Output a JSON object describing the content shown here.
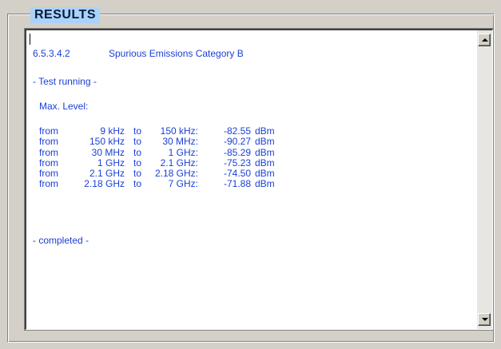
{
  "group": {
    "title": "RESULTS"
  },
  "results": {
    "section_number": "6.5.3.4.2",
    "section_title": "Spurious Emissions Category B",
    "running_text": "- Test running -",
    "max_level_label": "Max. Level:",
    "rows": [
      {
        "from_word": "from",
        "f1": "9 kHz",
        "to_word": "to",
        "f2": "150 kHz:",
        "value": "-82.55",
        "unit": "dBm"
      },
      {
        "from_word": "from",
        "f1": "150 kHz",
        "to_word": "to",
        "f2": "30 MHz:",
        "value": "-90.27",
        "unit": "dBm"
      },
      {
        "from_word": "from",
        "f1": "30 MHz",
        "to_word": "to",
        "f2": "1 GHz:",
        "value": "-85.29",
        "unit": "dBm"
      },
      {
        "from_word": "from",
        "f1": "1 GHz",
        "to_word": "to",
        "f2": "2.1 GHz:",
        "value": "-75.23",
        "unit": "dBm"
      },
      {
        "from_word": "from",
        "f1": "2.1 GHz",
        "to_word": "to",
        "f2": "2.18 GHz:",
        "value": "-74.50",
        "unit": "dBm"
      },
      {
        "from_word": "from",
        "f1": "2.18 GHz",
        "to_word": "to",
        "f2": "7 GHz:",
        "value": "-71.88",
        "unit": "dBm"
      }
    ],
    "completed_text": "- completed -"
  },
  "scrollbar": {
    "up_icon": "arrow-up-icon",
    "down_icon": "arrow-down-icon"
  },
  "colors": {
    "text": "#1a3fd6",
    "title_bg": "#aad2fb",
    "window_bg": "#d4d0c8"
  }
}
